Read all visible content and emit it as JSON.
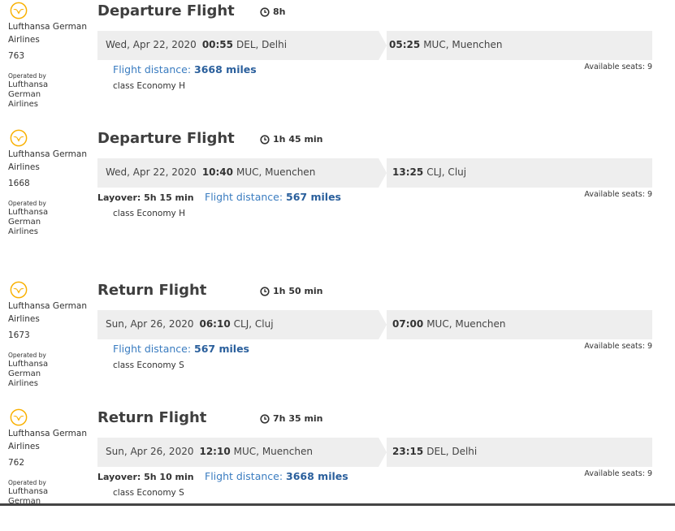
{
  "segments": [
    {
      "airline": "Lufthansa German Airlines",
      "flight_no": "763",
      "operated_by_label": "Operated by",
      "operated_by": "Lufthansa German Airlines",
      "title": "Departure Flight",
      "duration": "8h",
      "dep_date": "Wed, Apr 22, 2020",
      "dep_time": "00:55",
      "dep_place": "DEL, Delhi",
      "arr_time": "05:25",
      "arr_place": "MUC, Muenchen",
      "layover": "",
      "distance_label": "Flight distance:",
      "distance": "3668 miles",
      "class": "class Economy H",
      "seats": "Available seats: 9"
    },
    {
      "airline": "Lufthansa German Airlines",
      "flight_no": "1668",
      "operated_by_label": "Operated by",
      "operated_by": "Lufthansa German Airlines",
      "title": "Departure Flight",
      "duration": "1h 45 min",
      "dep_date": "Wed, Apr 22, 2020",
      "dep_time": "10:40",
      "dep_place": "MUC, Muenchen",
      "arr_time": "13:25",
      "arr_place": "CLJ, Cluj",
      "layover": "Layover: 5h 15 min",
      "distance_label": "Flight distance:",
      "distance": "567 miles",
      "class": "class Economy H",
      "seats": "Available seats: 9"
    },
    {
      "airline": "Lufthansa German Airlines",
      "flight_no": "1673",
      "operated_by_label": "Operated by",
      "operated_by": "Lufthansa German Airlines",
      "title": "Return Flight",
      "duration": "1h 50 min",
      "dep_date": "Sun, Apr 26, 2020",
      "dep_time": "06:10",
      "dep_place": "CLJ, Cluj",
      "arr_time": "07:00",
      "arr_place": "MUC, Muenchen",
      "layover": "",
      "distance_label": "Flight distance:",
      "distance": "567 miles",
      "class": "class Economy S",
      "seats": "Available seats: 9"
    },
    {
      "airline": "Lufthansa German Airlines",
      "flight_no": "762",
      "operated_by_label": "Operated by",
      "operated_by": "Lufthansa German",
      "title": "Return Flight",
      "duration": "7h 35 min",
      "dep_date": "Sun, Apr 26, 2020",
      "dep_time": "12:10",
      "dep_place": "MUC, Muenchen",
      "arr_time": "23:15",
      "arr_place": "DEL, Delhi",
      "layover": "Layover: 5h 10 min",
      "distance_label": "Flight distance:",
      "distance": "3668 miles",
      "class": "class Economy S",
      "seats": "Available seats: 9"
    }
  ],
  "icons": {
    "airline_logo": "lufthansa-crane-logo",
    "duration": "clock-icon"
  },
  "colors": {
    "logo": "#f9b000",
    "distance": "#3a7cc0",
    "bar": "#eeeeee"
  }
}
